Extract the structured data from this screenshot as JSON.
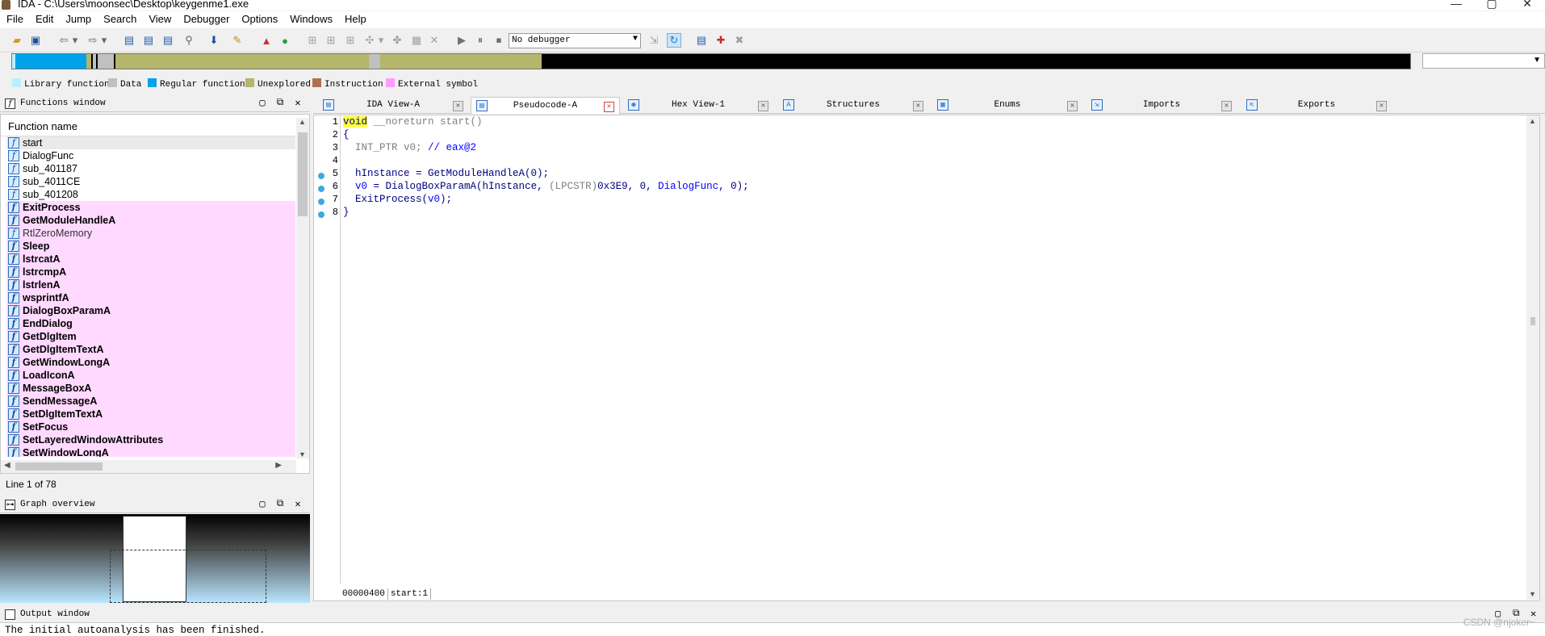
{
  "window": {
    "title": "IDA - C:\\Users\\moonsec\\Desktop\\keygenme1.exe",
    "controls": [
      "—",
      "▢",
      "✕"
    ]
  },
  "menu": [
    "File",
    "Edit",
    "Jump",
    "Search",
    "View",
    "Debugger",
    "Options",
    "Windows",
    "Help"
  ],
  "toolbar": {
    "debugger_select": "No debugger"
  },
  "legend": [
    {
      "label": "Library function",
      "color": "#b8f0ff"
    },
    {
      "label": "Data",
      "color": "#c0c0c0"
    },
    {
      "label": "Regular function",
      "color": "#00a2e8"
    },
    {
      "label": "Unexplored",
      "color": "#b5b56b"
    },
    {
      "label": "Instruction",
      "color": "#b07050"
    },
    {
      "label": "External symbol",
      "color": "#ff9cff"
    }
  ],
  "functions_panel": {
    "title": "Functions window",
    "column_header": "Function name",
    "items": [
      {
        "name": "start",
        "type": "selected"
      },
      {
        "name": "DialogFunc",
        "type": "regular"
      },
      {
        "name": "sub_401187",
        "type": "regular"
      },
      {
        "name": "sub_4011CE",
        "type": "regular"
      },
      {
        "name": "sub_401208",
        "type": "regular"
      },
      {
        "name": "ExitProcess",
        "type": "external"
      },
      {
        "name": "GetModuleHandleA",
        "type": "external"
      },
      {
        "name": "RtlZeroMemory",
        "type": "external-faint"
      },
      {
        "name": "Sleep",
        "type": "external"
      },
      {
        "name": "lstrcatA",
        "type": "external"
      },
      {
        "name": "lstrcmpA",
        "type": "external"
      },
      {
        "name": "lstrlenA",
        "type": "external"
      },
      {
        "name": "wsprintfA",
        "type": "external"
      },
      {
        "name": "DialogBoxParamA",
        "type": "external"
      },
      {
        "name": "EndDialog",
        "type": "external"
      },
      {
        "name": "GetDlgItem",
        "type": "external"
      },
      {
        "name": "GetDlgItemTextA",
        "type": "external"
      },
      {
        "name": "GetWindowLongA",
        "type": "external"
      },
      {
        "name": "LoadIconA",
        "type": "external"
      },
      {
        "name": "MessageBoxA",
        "type": "external"
      },
      {
        "name": "SendMessageA",
        "type": "external"
      },
      {
        "name": "SetDlgItemTextA",
        "type": "external"
      },
      {
        "name": "SetFocus",
        "type": "external"
      },
      {
        "name": "SetLayeredWindowAttributes",
        "type": "external"
      },
      {
        "name": "SetWindowLongA",
        "type": "external"
      }
    ],
    "line_info": "Line 1 of 78"
  },
  "graph_panel": {
    "title": "Graph overview"
  },
  "tabs": [
    {
      "label": "IDA View-A",
      "active": false
    },
    {
      "label": "Pseudocode-A",
      "active": true
    },
    {
      "label": "Hex View-1",
      "active": false
    },
    {
      "label": "Structures",
      "active": false
    },
    {
      "label": "Enums",
      "active": false
    },
    {
      "label": "Imports",
      "active": false
    },
    {
      "label": "Exports",
      "active": false
    }
  ],
  "code": {
    "line_numbers": [
      "1",
      "2",
      "3",
      "4",
      "5",
      "6",
      "7",
      "8"
    ],
    "status_address": "00000400",
    "status_location": "start:1"
  },
  "output": {
    "title": "Output window",
    "text": "The initial autoanalysis has been finished."
  },
  "watermark": "CSDN @njoker~"
}
